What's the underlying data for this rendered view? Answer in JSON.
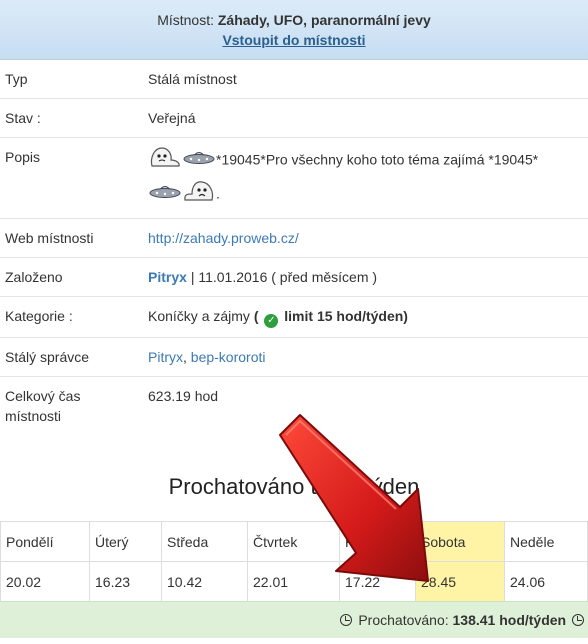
{
  "header": {
    "room_prefix": "Místnost: ",
    "room_name": "Záhady, UFO, paranormální jevy",
    "enter_link": "Vstoupit do místnosti"
  },
  "info": {
    "type": {
      "label": "Typ",
      "value": "Stálá místnost"
    },
    "state": {
      "label": "Stav :",
      "value": "Veřejná"
    },
    "description": {
      "label": "Popis",
      "text": "*19045*Pro všechny koho toto téma zajímá *19045*",
      "tail": "."
    },
    "web": {
      "label": "Web místnosti",
      "url": "http://zahady.proweb.cz/"
    },
    "founded": {
      "label": "Založeno",
      "user": "Pitryx",
      "date": "| 11.01.2016 ( před měsícem )"
    },
    "category": {
      "label": "Kategorie :",
      "value": "Koníčky a zájmy",
      "limit_open": "(",
      "limit": "limit 15 hod/týden",
      "limit_close": ")"
    },
    "admins": {
      "label": "Stálý správce",
      "admin1": "Pitryx",
      "sep": ", ",
      "admin2": "bep-kororoti"
    },
    "total_time": {
      "label": "Celkový čas místnosti",
      "value": "623.19 hod"
    }
  },
  "week": {
    "title": "Prochatováno tento týden",
    "days": [
      "Pondělí",
      "Úterý",
      "Středa",
      "Čtvrtek",
      "Pátek",
      "Sobota",
      "Neděle"
    ],
    "values": [
      "20.02",
      "16.23",
      "10.42",
      "22.01",
      "17.22",
      "28.45",
      "24.06"
    ],
    "highlight_index": 5,
    "highlight_color": "#fff3a6"
  },
  "footer": {
    "label": "Prochatováno: ",
    "value": "138.41 hod/týden",
    "bg_color": "#dff0d8"
  },
  "colors": {
    "header_bg": "#cfe3f5",
    "link": "#3c7ab5",
    "arrow": "#d41a1a"
  }
}
